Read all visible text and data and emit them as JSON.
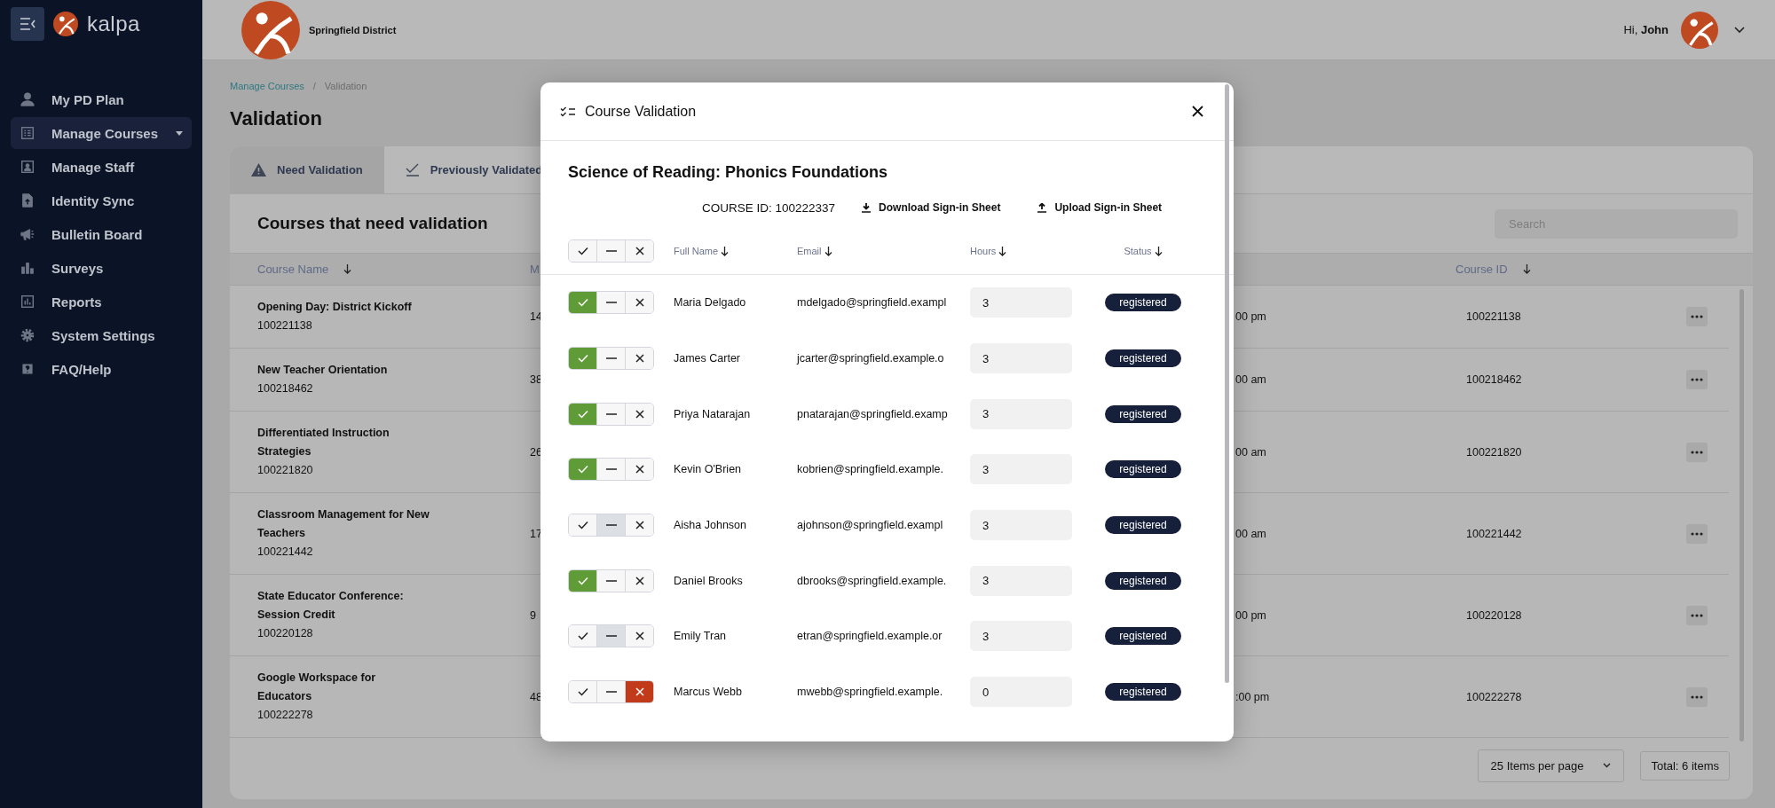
{
  "sidebar": {
    "logo_text": "kalpa",
    "items": [
      {
        "label": "My PD Plan",
        "selected": false,
        "submenu": false
      },
      {
        "label": "Manage Courses",
        "selected": true,
        "submenu": true
      },
      {
        "label": "Manage Staff",
        "selected": false,
        "submenu": false
      },
      {
        "label": "Identity Sync",
        "selected": false,
        "submenu": false
      },
      {
        "label": "Bulletin Board",
        "selected": false,
        "submenu": false
      },
      {
        "label": "Surveys",
        "selected": false,
        "submenu": false
      },
      {
        "label": "Reports",
        "selected": false,
        "submenu": false
      },
      {
        "label": "System Settings",
        "selected": false,
        "submenu": false
      },
      {
        "label": "FAQ/Help",
        "selected": false,
        "submenu": false
      }
    ]
  },
  "header": {
    "district": "Springfield District",
    "greeting": "Hi,",
    "user": "John"
  },
  "breadcrumb": {
    "items": [
      "Manage Courses",
      "Validation"
    ],
    "separator": "/"
  },
  "page_title": "Validation",
  "tabs": [
    {
      "label": "Need Validation",
      "selected": true
    },
    {
      "label": "Previously Validated",
      "selected": false
    }
  ],
  "card": {
    "title": "Courses that need validation",
    "search": {
      "placeholder": "Search"
    },
    "columns": {
      "course_name": "Course Name",
      "column_2": "M",
      "course_id": "Course ID"
    },
    "rows": [
      {
        "name": "Opening Day: District Kickoff",
        "id": "100221138",
        "column_2": "14",
        "column_3": "00 pm",
        "course_id": "100221138"
      },
      {
        "name": "New Teacher Orientation",
        "id": "100218462",
        "column_2": "38",
        "column_3": "00 am",
        "course_id": "100218462"
      },
      {
        "name": "Differentiated Instruction\nStrategies",
        "id": "100221820",
        "column_2": "26",
        "column_3": "00 am",
        "course_id": "100221820"
      },
      {
        "name": "Classroom Management for New\nTeachers",
        "id": "100221442",
        "column_2": "17",
        "column_3": "00 am",
        "course_id": "100221442"
      },
      {
        "name": "State Educator Conference:\nSession Credit",
        "id": "100220128",
        "column_2": "9",
        "column_3": "00 pm",
        "course_id": "100220128"
      },
      {
        "name": "Google Workspace for\nEducators",
        "id": "100222278",
        "column_2": "48",
        "column_3": ":00 pm",
        "course_id": "100222278"
      }
    ],
    "per_page": "25 Items per page",
    "total": "Total: 6 items"
  },
  "modal": {
    "title": "Course Validation",
    "course_name": "Science of Reading: Phonics Foundations",
    "course_id": "COURSE ID: 100222337",
    "actions": [
      {
        "kind": "download",
        "label": "Download Sign-in Sheet"
      },
      {
        "kind": "upload",
        "label": "Upload Sign-in Sheet"
      }
    ],
    "columns": [
      "Full Name",
      "Email",
      "Hours",
      "Status"
    ],
    "rows": [
      {
        "name": "Maria Delgado",
        "email": "mdelgado@springfield.exampl",
        "hours": "3",
        "status": "registered",
        "approved": true,
        "neutral": false,
        "rejected": false
      },
      {
        "name": "James Carter",
        "email": "jcarter@springfield.example.o",
        "hours": "3",
        "status": "registered",
        "approved": true,
        "neutral": false,
        "rejected": false
      },
      {
        "name": "Priya Natarajan",
        "email": "pnatarajan@springfield.examp",
        "hours": "3",
        "status": "registered",
        "approved": true,
        "neutral": false,
        "rejected": false
      },
      {
        "name": "Kevin O'Brien",
        "email": "kobrien@springfield.example.",
        "hours": "3",
        "status": "registered",
        "approved": true,
        "neutral": false,
        "rejected": false
      },
      {
        "name": "Aisha Johnson",
        "email": "ajohnson@springfield.exampl",
        "hours": "3",
        "status": "registered",
        "approved": false,
        "neutral": true,
        "rejected": false
      },
      {
        "name": "Daniel Brooks",
        "email": "dbrooks@springfield.example.",
        "hours": "3",
        "status": "registered",
        "approved": true,
        "neutral": false,
        "rejected": false
      },
      {
        "name": "Emily Tran",
        "email": "etran@springfield.example.or",
        "hours": "3",
        "status": "registered",
        "approved": false,
        "neutral": true,
        "rejected": false
      },
      {
        "name": "Marcus Webb",
        "email": "mwebb@springfield.example.",
        "hours": "0",
        "status": "registered",
        "approved": false,
        "neutral": false,
        "rejected": true
      }
    ]
  }
}
